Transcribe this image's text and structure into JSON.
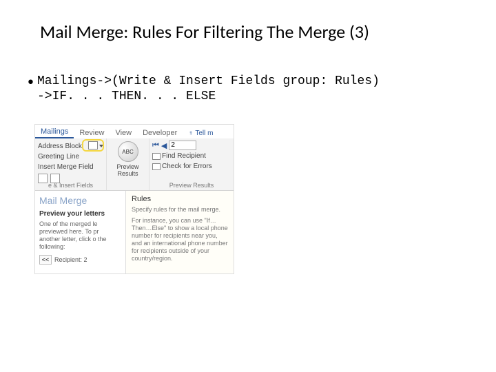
{
  "title": "Mail Merge: Rules For Filtering The Merge (3)",
  "bullet": {
    "line1": "Mailings->(Write & Insert Fields group: Rules)",
    "line2": "->IF. . . THEN. . . ELSE"
  },
  "ribbon": {
    "tabs": {
      "mailings": "Mailings",
      "review": "Review",
      "view": "View",
      "developer": "Developer",
      "tell": "Tell m"
    },
    "write_group": {
      "address_block": "Address Block",
      "greeting_line": "Greeting Line",
      "insert_merge_field": "Insert Merge Field",
      "label": "e & Insert Fields"
    },
    "preview_group": {
      "button": "Preview Results",
      "label": "Preview Results"
    },
    "nav_group": {
      "record": "2",
      "find_recipient": "Find Recipient",
      "check_errors": "Check for Errors",
      "label": "Preview Results"
    }
  },
  "pane": {
    "mail_merge_title": "Mail Merge",
    "preview_heading": "Preview your letters",
    "preview_body": "One of the merged le previewed here. To pr another letter, click o the following:",
    "recipient_label": "Recipient: 2",
    "prev": "<<"
  },
  "tooltip": {
    "title": "Rules",
    "subtitle": "Specify rules for the mail merge.",
    "body": "For instance, you can use \"If…Then…Else\" to show a local phone number for recipients near you, and an international phone number for recipients outside of your country/region."
  }
}
